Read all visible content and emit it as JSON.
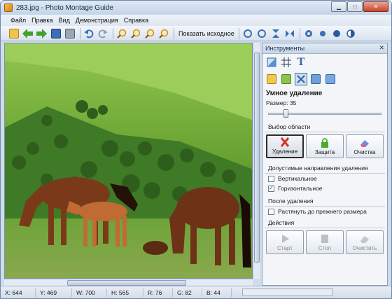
{
  "window": {
    "title": "283.jpg - Photo Montage Guide"
  },
  "menu": [
    "Файл",
    "Правка",
    "Вид",
    "Демонстрация",
    "Справка"
  ],
  "toolbar": {
    "show_original_label": "Показать исходное"
  },
  "panel": {
    "title": "Инструменты",
    "section_title": "Умное удаление",
    "size_label": "Размер: 35",
    "size_value": 35,
    "area_group": "Выбор области",
    "area_buttons": [
      "Удаление",
      "Защита",
      "Очистка"
    ],
    "directions_group": "Допустимые направления удаления",
    "vertical_label": "Вертикальное",
    "vertical_checked": false,
    "horizontal_label": "Горизонтальное",
    "horizontal_checked": true,
    "after_group": "После удаления",
    "stretch_label": "Растянуть до прежнего размера",
    "stretch_checked": false,
    "actions_group": "Действия",
    "action_buttons": [
      "Старт",
      "Стоп",
      "Очистить"
    ]
  },
  "status": {
    "x": "X: 644",
    "y": "Y: 469",
    "w": "W: 700",
    "h": "H: 565",
    "r": "R: 76",
    "g": "G: 82",
    "b": "B: 44"
  },
  "colors": {
    "accent": "#3c6ea5",
    "delete_red": "#d8322a",
    "protect_green": "#4caa2c"
  }
}
